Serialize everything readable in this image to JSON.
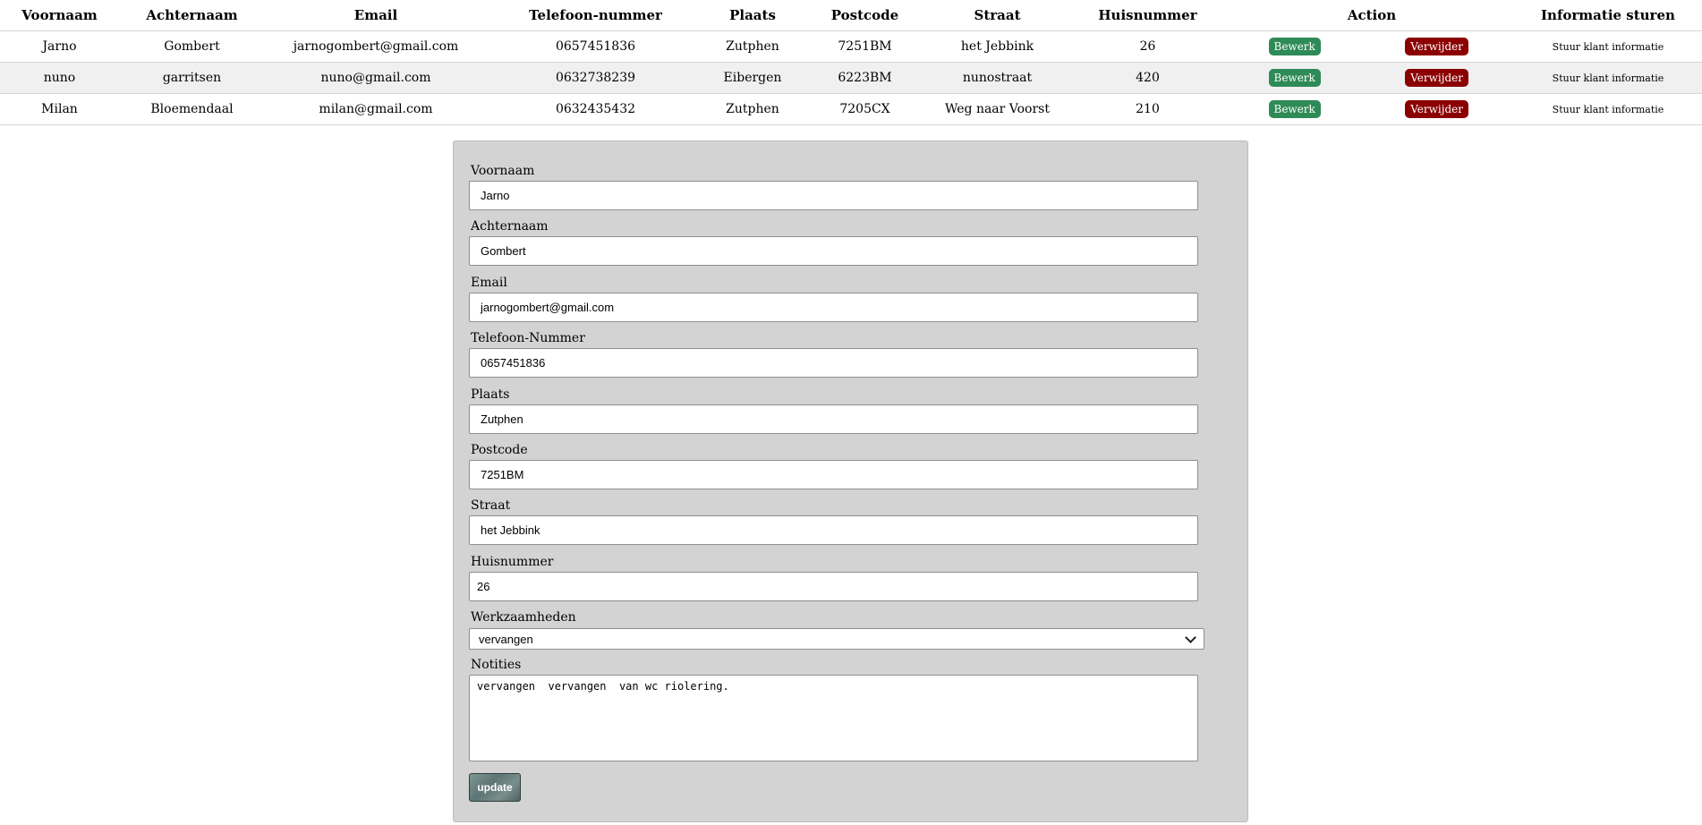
{
  "table": {
    "headers": [
      "Voornaam",
      "Achternaam",
      "Email",
      "Telefoon-nummer",
      "Plaats",
      "Postcode",
      "Straat",
      "Huisnummer",
      "Action",
      "Informatie sturen"
    ],
    "rows": [
      {
        "voornaam": "Jarno",
        "achternaam": "Gombert",
        "email": "jarnogombert@gmail.com",
        "telefoon": "0657451836",
        "plaats": "Zutphen",
        "postcode": "7251BM",
        "straat": "het Jebbink",
        "huisnummer": "26"
      },
      {
        "voornaam": "nuno",
        "achternaam": "garritsen",
        "email": "nuno@gmail.com",
        "telefoon": "0632738239",
        "plaats": "Eibergen",
        "postcode": "6223BM",
        "straat": "nunostraat",
        "huisnummer": "420"
      },
      {
        "voornaam": "Milan",
        "achternaam": "Bloemendaal",
        "email": "milan@gmail.com",
        "telefoon": "0632435432",
        "plaats": "Zutphen",
        "postcode": "7205CX",
        "straat": "Weg naar Voorst",
        "huisnummer": "210"
      }
    ],
    "edit_label": "Bewerk",
    "delete_label": "Verwijder",
    "info_label": "Stuur klant informatie",
    "colors": {
      "edit": "#2e8b57",
      "delete": "#8b0000",
      "stripe": "#f0f0f0"
    }
  },
  "form": {
    "voornaam": {
      "label": "Voornaam",
      "value": "Jarno"
    },
    "achternaam": {
      "label": "Achternaam",
      "value": "Gombert"
    },
    "email": {
      "label": "Email",
      "value": "jarnogombert@gmail.com"
    },
    "telefoon": {
      "label": "Telefoon-Nummer",
      "value": "0657451836"
    },
    "plaats": {
      "label": "Plaats",
      "value": "Zutphen"
    },
    "postcode": {
      "label": "Postcode",
      "value": "7251BM"
    },
    "straat": {
      "label": "Straat",
      "value": "het Jebbink"
    },
    "huisnummer": {
      "label": "Huisnummer",
      "value": "26"
    },
    "werkzaamheden": {
      "label": "Werkzaamheden",
      "selected": "vervangen"
    },
    "notities": {
      "label": "Notities",
      "value": "vervangen  vervangen  van wc riolering."
    },
    "update_label": "update",
    "panel_color": "#d3d3d3"
  }
}
